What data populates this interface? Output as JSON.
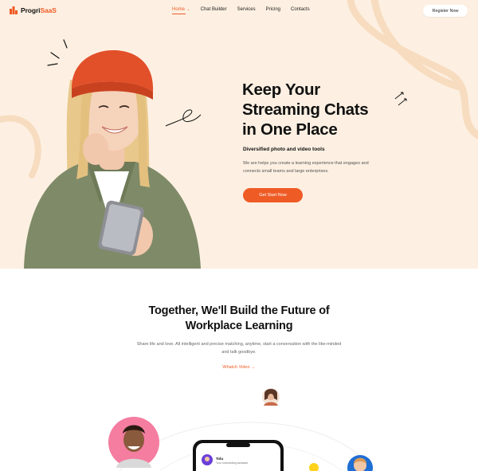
{
  "brand": {
    "name_part1": "Progri",
    "name_part2": "SaaS",
    "accent": "#ef5b25"
  },
  "nav": {
    "items": [
      {
        "label": "Home",
        "active": true
      },
      {
        "label": "Chat Builder"
      },
      {
        "label": "Services"
      },
      {
        "label": "Pricing"
      },
      {
        "label": "Contacts"
      }
    ],
    "register_label": "Register Now"
  },
  "hero": {
    "title_lines": [
      "Keep Your",
      "Streaming Chats",
      "in One Place"
    ],
    "subtitle": "Diversified photo and video tools",
    "description": "We are helps you create a learning experience that engages and connects small teams and large enterprises.",
    "cta_label": "Get Start Now",
    "bg_color": "#fdf0e2"
  },
  "section2": {
    "title_line1": "Together, We'll Build the Future of",
    "title_line2": "Workplace Learning",
    "description": "Share life and love. All intelligent and precise matching, anytime, start a conversation with the like-minded and talk goodbye.",
    "watch_label": "Whatch Video"
  },
  "phone_card": {
    "name": "Tolu",
    "subtitle": "Your onboarding assistant"
  }
}
